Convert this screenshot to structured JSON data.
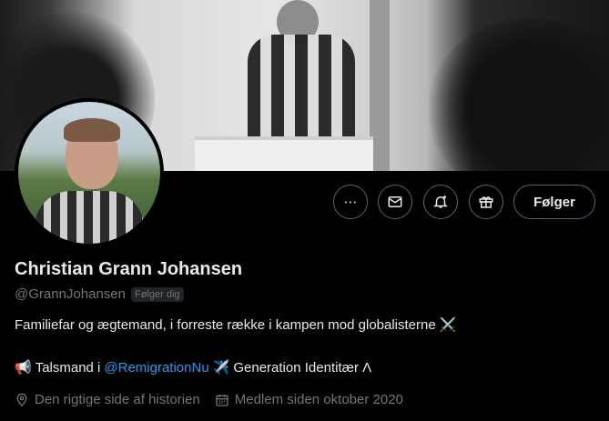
{
  "profile": {
    "display_name": "Christian Grann Johansen",
    "handle": "@GrannJohansen",
    "follows_you": "Følger dig",
    "bio": "Familiefar og ægtemand, i forreste række i kampen mod globalisterne ⚔️",
    "bio_line2": {
      "megaphone": "📢",
      "text_a": "Talsmand i",
      "mention": "@RemigrationNu",
      "airplane": "✈️",
      "text_b": "Generation Identitær Λ"
    },
    "location": "Den rigtige side af historien",
    "joined": "Medlem siden oktober 2020"
  },
  "actions": {
    "more_label": "⋯",
    "follow_label": "Følger"
  },
  "colors": {
    "accent": "#1d9bf0",
    "secondary_text": "#71767b",
    "border": "#536471"
  },
  "icons": [
    "more-icon",
    "message-icon",
    "notification-bell-icon",
    "gift-icon",
    "location-icon",
    "calendar-icon"
  ]
}
